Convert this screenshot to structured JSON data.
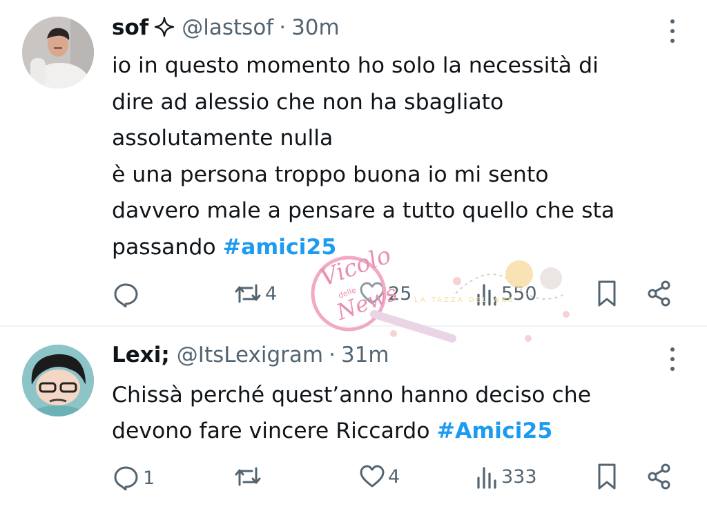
{
  "tweets": [
    {
      "name": "sof",
      "handle": "@lastsof",
      "separator": "·",
      "time": "30m",
      "text_lines": [
        "io in questo momento ho solo la necessità di",
        "dire ad alessio che non ha sbagliato",
        "assolutamente nulla",
        "è una persona troppo buona io mi sento",
        "davvero male a pensare a tutto quello che sta",
        "passando "
      ],
      "hashtag": "#amici25",
      "replies": "",
      "reposts": "4",
      "likes": "25",
      "views": "550"
    },
    {
      "name": "Lexi;",
      "handle": "@ItsLexigram",
      "separator": "·",
      "time": "31m",
      "text_lines": [
        "Chissà perché quest’anno hanno deciso che",
        "devono fare vincere Riccardo "
      ],
      "hashtag": "#Amici25",
      "replies": "1",
      "reposts": "",
      "likes": "4",
      "views": "333"
    }
  ],
  "watermark": {
    "text": "Vicolo delle News"
  },
  "icons": {
    "reply": "reply-icon",
    "repost": "repost-icon",
    "like": "heart-icon",
    "views": "views-icon",
    "bookmark": "bookmark-icon",
    "share": "share-icon",
    "more": "more-options-icon",
    "verified": "verified-sparkle-icon"
  },
  "colors": {
    "text": "#0f1419",
    "secondary": "#536471",
    "hashtag": "#1d9bf0",
    "divider": "#eff3f4"
  }
}
